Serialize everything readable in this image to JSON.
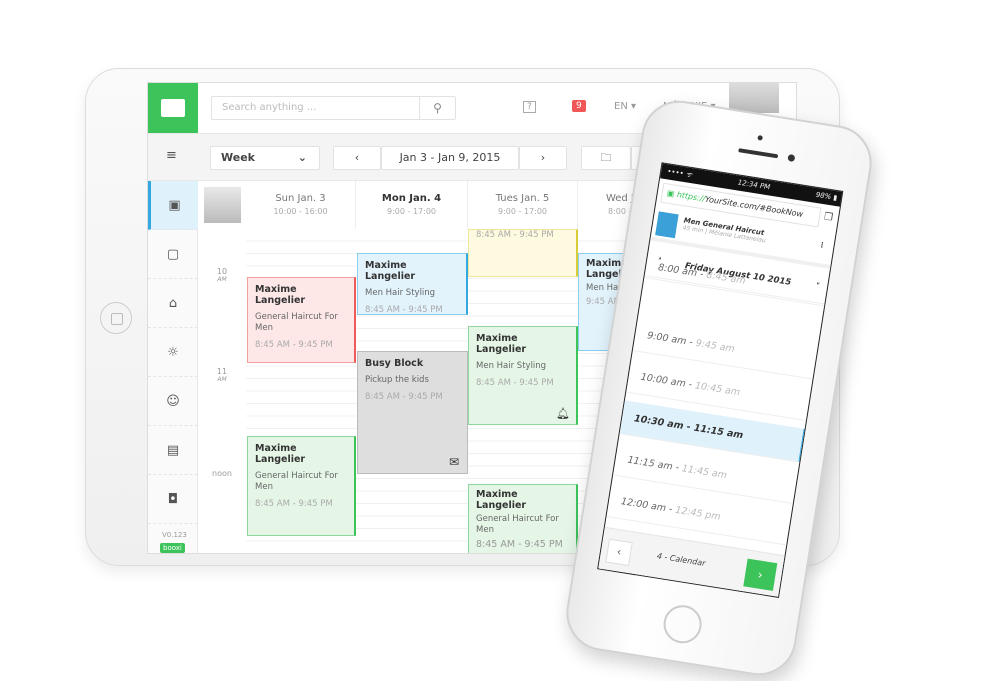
{
  "header": {
    "search_placeholder": "Search anything ...",
    "notifications": "9",
    "language": "EN ▾",
    "user": "MÉLANIE ▾"
  },
  "toolbar": {
    "view": "Week",
    "range": "Jan 3 - Jan 9, 2015",
    "prev": "‹",
    "next": "›"
  },
  "sidebar": {
    "version": "V0.123",
    "brand": "booxi"
  },
  "days": [
    {
      "name": "Sun Jan. 3",
      "hours": "10:00 - 16:00"
    },
    {
      "name": "Mon Jan. 4",
      "hours": "9:00 - 17:00"
    },
    {
      "name": "Tues Jan. 5",
      "hours": "9:00 - 17:00"
    },
    {
      "name": "Wed Jan. 6",
      "hours": "8:00 - 18:00"
    }
  ],
  "hours": [
    {
      "h": "10",
      "ap": "AM"
    },
    {
      "h": "11",
      "ap": "AM"
    },
    {
      "h": "noon",
      "ap": ""
    }
  ],
  "events": [
    {
      "title": "Maxime Langelier",
      "service": "General Haircut For Men",
      "time": "8:45 AM - 9:45 PM"
    },
    {
      "title": "Maxime Langelier",
      "service": "General Haircut For Men",
      "time": "8:45 AM - 9:45 PM"
    },
    {
      "title": "Maxime Langelier",
      "service": "Men Hair Styling",
      "time": "8:45 AM - 9:45 PM"
    },
    {
      "title": "Busy Block",
      "service": "Pickup the kids",
      "time": "8:45 AM - 9:45 PM"
    },
    {
      "title": "Maxime Langelier",
      "service": "Men Hair Styling",
      "time": "8:45 AM - 9:45 PM"
    },
    {
      "title": "Maxime Langelier",
      "service": "General Haircut For Men",
      "time": "8:45 AM - 9:45 PM"
    },
    {
      "title": "Maxime Langelier",
      "service": "Men Hair Styling",
      "time": "9:45 AM - 10:45 AM"
    },
    {
      "title": "",
      "service": "",
      "time": "8:45 AM - 9:45 PM"
    }
  ],
  "phone": {
    "status": {
      "signal": "•••• ᯤ",
      "time": "12:34 PM",
      "battery": "98% ▮"
    },
    "url_scheme": "https://",
    "url_rest": "YourSite.com/#BookNow",
    "service": "Men General Haircut",
    "service_meta": "45 min | Mélanie Lattanelau",
    "date": "Friday August 10 2015",
    "slots": [
      {
        "start": "8:00 am",
        "end": "8:45 am",
        "selected": false
      },
      {
        "start": "9:00 am",
        "end": "9:45 am",
        "selected": false
      },
      {
        "start": "10:00 am",
        "end": "10:45 am",
        "selected": false
      },
      {
        "start": "10:30 am",
        "end": "11:15 am",
        "selected": true
      },
      {
        "start": "11:15 am",
        "end": "11:45 am",
        "selected": false
      },
      {
        "start": "12:00 am",
        "end": "12:45 pm",
        "selected": false
      }
    ],
    "step": "4 - Calendar"
  },
  "colors": {
    "brand": "#3cc35a",
    "accent": "#32a8e2",
    "badge": "#f25757"
  }
}
